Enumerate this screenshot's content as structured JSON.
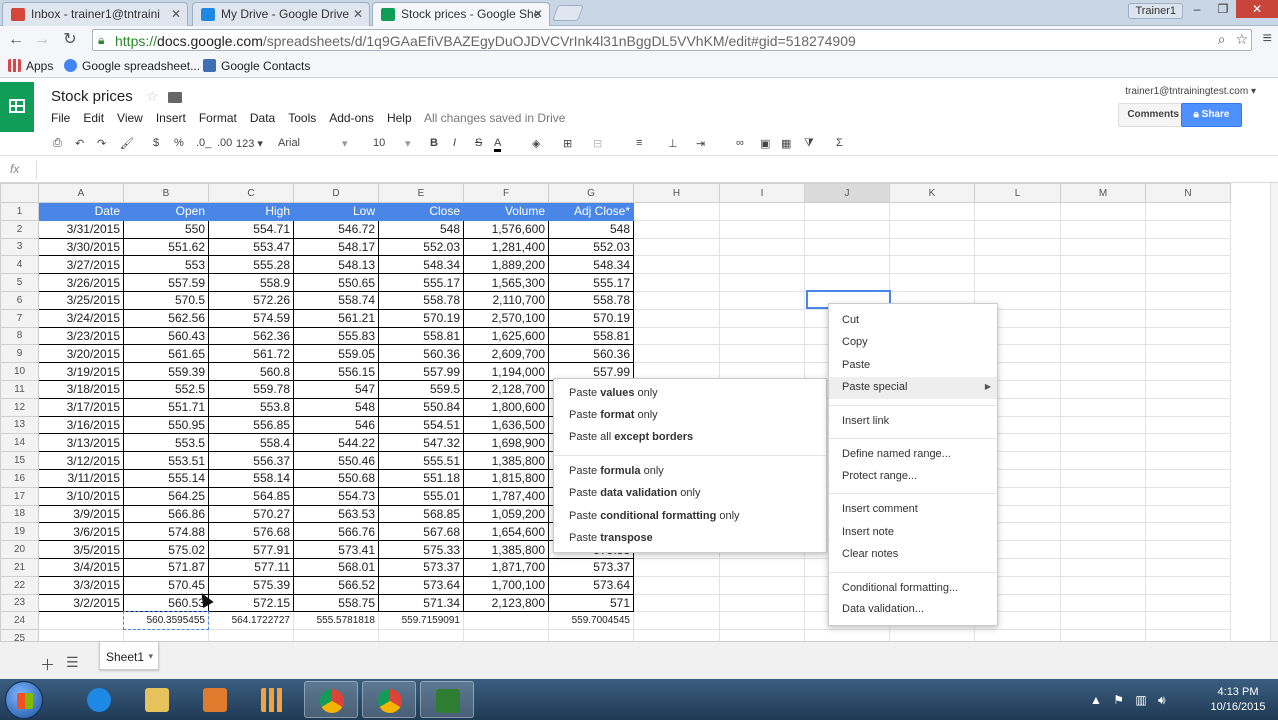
{
  "tabs": [
    {
      "title": "Inbox - trainer1@tntraini",
      "color": "#d44638"
    },
    {
      "title": "My Drive - Google Drive",
      "color": "#1e88e5"
    },
    {
      "title": "Stock prices - Google She",
      "color": "#0f9d58"
    }
  ],
  "window": {
    "user_label": "Trainer1"
  },
  "omnibox": {
    "scheme": "https://",
    "host": "docs.google.com",
    "path": "/spreadsheets/d/1q9GAaEfiVBAZEgyDuOJDVCVrInk4l31nBggDL5VVhKM/edit#gid=518274909"
  },
  "bookmarks": [
    {
      "label": "Apps"
    },
    {
      "label": "Google spreadsheet..."
    },
    {
      "label": "Google Contacts"
    }
  ],
  "doc": {
    "title": "Stock prices",
    "save_status": "All changes saved in Drive",
    "account": "trainer1@tntrainingtest.com ▾"
  },
  "menu": [
    "File",
    "Edit",
    "View",
    "Insert",
    "Format",
    "Data",
    "Tools",
    "Add-ons",
    "Help"
  ],
  "buttons": {
    "comments": "Comments",
    "share": "Share"
  },
  "toolbar": {
    "currency": "$",
    "percent": "%",
    "dec_less": ".0_",
    ".dec_more": ".00",
    "dec_more": ".00",
    "number_fmt": "123 ▾",
    "font": "Arial",
    "font_size": "10",
    "bold": "B",
    "italic": "I",
    "strike": "S",
    "text_color": "A",
    "sigma": "Σ"
  },
  "formula": {
    "fx": "fx",
    "value": ""
  },
  "columns": [
    "A",
    "B",
    "C",
    "D",
    "E",
    "F",
    "G",
    "H",
    "I",
    "J",
    "K",
    "L",
    "M",
    "N"
  ],
  "headers": [
    "Date",
    "Open",
    "High",
    "Low",
    "Close",
    "Volume",
    "Adj Close*"
  ],
  "rows": [
    [
      "3/31/2015",
      "550",
      "554.71",
      "546.72",
      "548",
      "1,576,600",
      "548"
    ],
    [
      "3/30/2015",
      "551.62",
      "553.47",
      "548.17",
      "552.03",
      "1,281,400",
      "552.03"
    ],
    [
      "3/27/2015",
      "553",
      "555.28",
      "548.13",
      "548.34",
      "1,889,200",
      "548.34"
    ],
    [
      "3/26/2015",
      "557.59",
      "558.9",
      "550.65",
      "555.17",
      "1,565,300",
      "555.17"
    ],
    [
      "3/25/2015",
      "570.5",
      "572.26",
      "558.74",
      "558.78",
      "2,110,700",
      "558.78"
    ],
    [
      "3/24/2015",
      "562.56",
      "574.59",
      "561.21",
      "570.19",
      "2,570,100",
      "570.19"
    ],
    [
      "3/23/2015",
      "560.43",
      "562.36",
      "555.83",
      "558.81",
      "1,625,600",
      "558.81"
    ],
    [
      "3/20/2015",
      "561.65",
      "561.72",
      "559.05",
      "560.36",
      "2,609,700",
      "560.36"
    ],
    [
      "3/19/2015",
      "559.39",
      "560.8",
      "556.15",
      "557.99",
      "1,194,000",
      "557.99"
    ],
    [
      "3/18/2015",
      "552.5",
      "559.78",
      "547",
      "559.5",
      "2,128,700",
      "559.5"
    ],
    [
      "3/17/2015",
      "551.71",
      "553.8",
      "548",
      "550.84",
      "1,800,600",
      "550.84"
    ],
    [
      "3/16/2015",
      "550.95",
      "556.85",
      "546",
      "554.51",
      "1,636,500",
      "554.51"
    ],
    [
      "3/13/2015",
      "553.5",
      "558.4",
      "544.22",
      "547.32",
      "1,698,900",
      "547.32"
    ],
    [
      "3/12/2015",
      "553.51",
      "556.37",
      "550.46",
      "555.51",
      "1,385,800",
      "555.51"
    ],
    [
      "3/11/2015",
      "555.14",
      "558.14",
      "550.68",
      "551.18",
      "1,815,800",
      "551.18"
    ],
    [
      "3/10/2015",
      "564.25",
      "564.85",
      "554.73",
      "555.01",
      "1,787,400",
      "555.01"
    ],
    [
      "3/9/2015",
      "566.86",
      "570.27",
      "563.53",
      "568.85",
      "1,059,200",
      "568.85"
    ],
    [
      "3/6/2015",
      "574.88",
      "576.68",
      "566.76",
      "567.68",
      "1,654,600",
      "567.68"
    ],
    [
      "3/5/2015",
      "575.02",
      "577.91",
      "573.41",
      "575.33",
      "1,385,800",
      "575.33"
    ],
    [
      "3/4/2015",
      "571.87",
      "577.11",
      "568.01",
      "573.37",
      "1,871,700",
      "573.37"
    ],
    [
      "3/3/2015",
      "570.45",
      "575.39",
      "566.52",
      "573.64",
      "1,700,100",
      "573.64"
    ],
    [
      "3/2/2015",
      "560.53",
      "572.15",
      "558.75",
      "571.34",
      "2,123,800",
      "571"
    ]
  ],
  "averages": [
    "",
    "560.3595455",
    "564.1722727",
    "555.5781818",
    "559.7159091",
    "",
    "559.7004545"
  ],
  "row_numbers": [
    "1",
    "2",
    "3",
    "4",
    "5",
    "6",
    "7",
    "8",
    "9",
    "10",
    "11",
    "12",
    "13",
    "14",
    "15",
    "16",
    "17",
    "18",
    "19",
    "20",
    "21",
    "22",
    "23",
    "24",
    "25"
  ],
  "context_menu": {
    "cut": "Cut",
    "copy": "Copy",
    "paste": "Paste",
    "paste_special": "Paste special",
    "insert_link": "Insert link",
    "define_named_range": "Define named range...",
    "protect_range": "Protect range...",
    "insert_comment": "Insert comment",
    "insert_note": "Insert note",
    "clear_notes": "Clear notes",
    "conditional_formatting": "Conditional formatting...",
    "data_validation": "Data validation..."
  },
  "paste_special_menu": [
    {
      "pre": "Paste ",
      "bold": "values",
      "post": " only"
    },
    {
      "pre": "Paste ",
      "bold": "format",
      "post": " only"
    },
    {
      "pre": "Paste all ",
      "bold": "except borders",
      "post": ""
    },
    {
      "pre": "Paste ",
      "bold": "formula",
      "post": " only"
    },
    {
      "pre": "Paste ",
      "bold": "data validation",
      "post": " only"
    },
    {
      "pre": "Paste ",
      "bold": "conditional formatting",
      "post": " only"
    },
    {
      "pre": "Paste ",
      "bold": "transpose",
      "post": ""
    }
  ],
  "sheet_tab": {
    "name": "Sheet1"
  },
  "clock": {
    "time": "4:13 PM",
    "date": "10/16/2015"
  }
}
